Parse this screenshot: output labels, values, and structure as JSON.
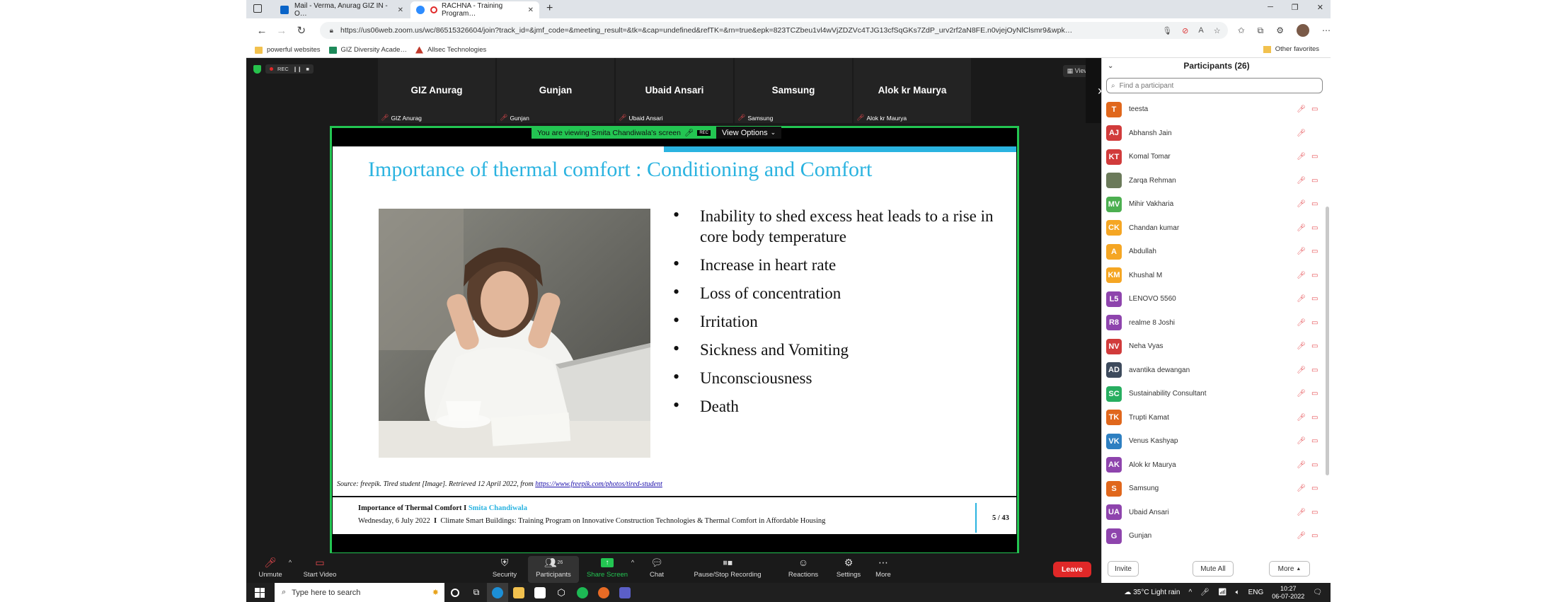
{
  "browser": {
    "tabs": [
      {
        "title": "Mail - Verma, Anurag GIZ IN - O…",
        "active": false
      },
      {
        "title": "RACHNA - Training Program…",
        "active": true
      }
    ],
    "url": "https://us06web.zoom.us/wc/86515326604/join?track_id=&jmf_code=&meeting_result=&tk=&cap=undefined&refTK=&rn=true&epk=823TCZbeu1vl4wVjZDZVc4TJG13cfSqGKs7ZdP_urv2rf2aN8FE.n0vjejOyNlClsmr9&wpk…",
    "bookmarks": [
      "powerful websites",
      "GIZ Diversity Acade…",
      "Allsec Technologies"
    ],
    "other_favorites": "Other favorites"
  },
  "zoom": {
    "rec_label": "REC",
    "view_label": "View",
    "thumbnails": [
      {
        "name": "GIZ Anurag",
        "label": "GIZ Anurag"
      },
      {
        "name": "Gunjan",
        "label": "Gunjan"
      },
      {
        "name": "Ubaid Ansari",
        "label": "Ubaid Ansari"
      },
      {
        "name": "Samsung",
        "label": "Samsung"
      },
      {
        "name": "Alok kr Maurya",
        "label": "Alok kr Maurya"
      }
    ],
    "viewing_msg": "You are viewing Smita Chandiwala's screen",
    "rec_badge": "REC",
    "view_options": "View Options",
    "toolbar": {
      "unmute": "Unmute",
      "start_video": "Start Video",
      "security": "Security",
      "participants": "Participants",
      "participants_count": "26",
      "share_screen": "Share Screen",
      "chat": "Chat",
      "pause_stop": "Pause/Stop Recording",
      "reactions": "Reactions",
      "settings": "Settings",
      "more": "More",
      "leave": "Leave"
    }
  },
  "slide": {
    "title": "Importance of thermal comfort : Conditioning and Comfort",
    "bullets": [
      "Inability to shed excess heat leads to a rise in core body temperature",
      "Increase in heart rate",
      "Loss of concentration",
      "Irritation",
      "Sickness and Vomiting",
      "Unconsciousness",
      "Death"
    ],
    "source_prefix": "Source: freepik. Tired student [Image]. Retrieved 12 April 2022, from",
    "source_link": "https://www.freepik.com/photos/tired-student",
    "footer_title": "Importance of Thermal Comfort I",
    "footer_presenter": "Smita Chandiwala",
    "footer_date": "Wednesday, 6 July 2022",
    "footer_sep": "I",
    "footer_program": "Climate Smart Buildings: Training Program on Innovative Construction Technologies & Thermal Comfort in Affordable Housing",
    "page": "5 / 43"
  },
  "participants": {
    "header": "Participants (26)",
    "search_placeholder": "Find a participant",
    "list": [
      {
        "initials": "T",
        "name": "teesta",
        "color": "#e0671c",
        "video_off": true
      },
      {
        "initials": "AJ",
        "name": "Abhansh Jain",
        "color": "#d13b3b",
        "video_off": false
      },
      {
        "initials": "KT",
        "name": "Komal Tomar",
        "color": "#d13b3b",
        "video_off": true
      },
      {
        "initials": "",
        "name": "Zarqa Rehman",
        "color": "#6b7a5a",
        "video_off": true
      },
      {
        "initials": "MV",
        "name": "Mihir Vakharia",
        "color": "#4caf50",
        "video_off": true
      },
      {
        "initials": "CK",
        "name": "Chandan kumar",
        "color": "#f5a623",
        "video_off": true
      },
      {
        "initials": "A",
        "name": "Abdullah",
        "color": "#f5a623",
        "video_off": true
      },
      {
        "initials": "KM",
        "name": "Khushal M",
        "color": "#f5a623",
        "video_off": true
      },
      {
        "initials": "L5",
        "name": "LENOVO 5560",
        "color": "#8e44ad",
        "video_off": true
      },
      {
        "initials": "R8",
        "name": "realme 8 Joshi",
        "color": "#8e44ad",
        "video_off": true
      },
      {
        "initials": "NV",
        "name": "Neha Vyas",
        "color": "#d13b3b",
        "video_off": true
      },
      {
        "initials": "AD",
        "name": "avantika dewangan",
        "color": "#3d4a5c",
        "video_off": true
      },
      {
        "initials": "SC",
        "name": "Sustainability Consultant",
        "color": "#27ae60",
        "video_off": true
      },
      {
        "initials": "TK",
        "name": "Trupti Kamat",
        "color": "#e0671c",
        "video_off": true
      },
      {
        "initials": "VK",
        "name": "Venus Kashyap",
        "color": "#2d7fc1",
        "video_off": true
      },
      {
        "initials": "AK",
        "name": "Alok kr Maurya",
        "color": "#8e44ad",
        "video_off": true
      },
      {
        "initials": "S",
        "name": "Samsung",
        "color": "#e0671c",
        "video_off": true
      },
      {
        "initials": "UA",
        "name": "Ubaid Ansari",
        "color": "#8e44ad",
        "video_off": true
      },
      {
        "initials": "G",
        "name": "Gunjan",
        "color": "#8e44ad",
        "video_off": true
      }
    ],
    "invite": "Invite",
    "mute_all": "Mute All",
    "more": "More"
  },
  "taskbar": {
    "search_placeholder": "Type here to search",
    "weather": "35°C  Light rain",
    "lang": "ENG",
    "time": "10:27",
    "date": "06-07-2022"
  },
  "colors": {
    "zoom_green": "#23c552",
    "slide_accent": "#2ab3e0",
    "leave_red": "#e02828",
    "muted_red": "#e5484d"
  }
}
